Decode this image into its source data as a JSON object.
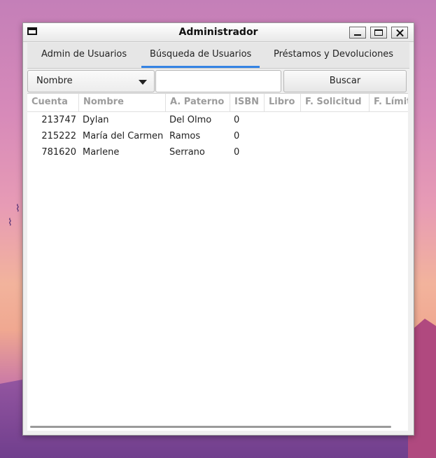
{
  "window": {
    "title": "Administrador"
  },
  "tabs": [
    {
      "label": "Admin de Usuarios"
    },
    {
      "label": "Búsqueda de Usuarios"
    },
    {
      "label": "Préstamos y Devoluciones"
    }
  ],
  "active_tab": "Búsqueda de Usuarios",
  "search": {
    "field_selected": "Nombre",
    "query_value": "",
    "button_label": "Buscar"
  },
  "table": {
    "columns": [
      "Cuenta",
      "Nombre",
      "A. Paterno",
      "ISBN",
      "Libro",
      "F. Solicitud",
      "F. Límite"
    ],
    "rows": [
      {
        "cuenta": "213747",
        "nombre": "Dylan",
        "paterno": "Del Olmo",
        "isbn": "0",
        "libro": "",
        "solicitud": "",
        "limite": ""
      },
      {
        "cuenta": "215222",
        "nombre": "María del Carmen",
        "paterno": "Ramos",
        "isbn": "0",
        "libro": "",
        "solicitud": "",
        "limite": ""
      },
      {
        "cuenta": "781620",
        "nombre": "Marlene",
        "paterno": "Serrano",
        "isbn": "0",
        "libro": "",
        "solicitud": "",
        "limite": ""
      }
    ]
  },
  "colors": {
    "accent": "#3584e4",
    "header_text": "#9c9c9c"
  }
}
